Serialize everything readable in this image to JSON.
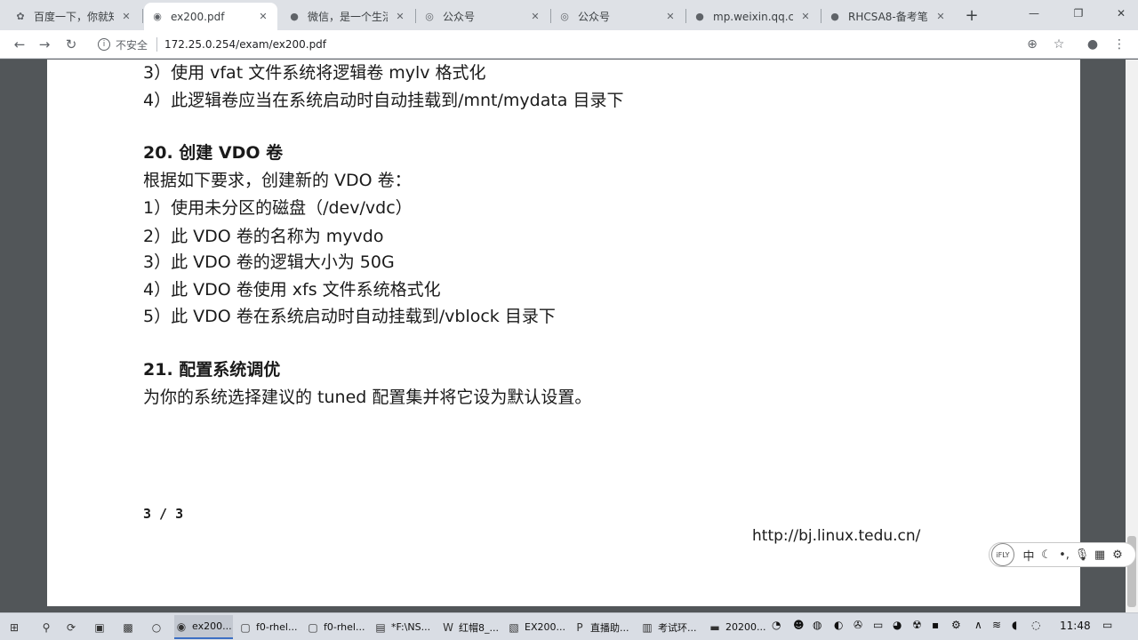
{
  "tabs": [
    {
      "title": "百度一下，你就知",
      "icon": "paw-icon"
    },
    {
      "title": "ex200.pdf",
      "icon": "globe-icon"
    },
    {
      "title": "微信，是一个生活",
      "icon": "chat-icon"
    },
    {
      "title": "公众号",
      "icon": "globe-icon"
    },
    {
      "title": "公众号",
      "icon": "globe-icon"
    },
    {
      "title": "mp.weixin.qq.co",
      "icon": "chat-icon"
    },
    {
      "title": "RHCSA8-备考笔",
      "icon": "chat-icon"
    }
  ],
  "active_tab": 1,
  "address": {
    "security_label": "不安全",
    "url": "172.25.0.254/exam/ex200.pdf"
  },
  "document": {
    "lines": [
      "3）使用 vfat 文件系统将逻辑卷 mylv 格式化",
      "4）此逻辑卷应当在系统启动时自动挂载到/mnt/mydata 目录下",
      "20. 创建 VDO 卷",
      "根据如下要求，创建新的 VDO 卷：",
      "1）使用未分区的磁盘（/dev/vdc）",
      "2）此 VDO 卷的名称为 myvdo",
      "3）此 VDO 卷的逻辑大小为 50G",
      "4）此 VDO 卷使用 xfs 文件系统格式化",
      "5）此 VDO 卷在系统启动时自动挂载到/vblock 目录下",
      "21. 配置系统调优",
      "为你的系统选择建议的 tuned 配置集并将它设为默认设置。"
    ],
    "page_number": "3 / 3",
    "footer_url": "http://bj.linux.tedu.cn/"
  },
  "ime": {
    "logo": "iFLY",
    "mode": "中"
  },
  "taskbar": {
    "items": [
      {
        "label": "ex200...",
        "icon": "chrome-icon"
      },
      {
        "label": "f0-rhel...",
        "icon": "vm-icon"
      },
      {
        "label": "f0-rhel...",
        "icon": "vm-icon"
      },
      {
        "label": "*F:\\NS...",
        "icon": "notepad-icon"
      },
      {
        "label": "红帽8_...",
        "icon": "word-icon"
      },
      {
        "label": "EX200...",
        "icon": "pdf-icon"
      },
      {
        "label": "直播助...",
        "icon": "app-icon"
      },
      {
        "label": "考试环...",
        "icon": "doc-icon"
      },
      {
        "label": "20200...",
        "icon": "folder-icon"
      }
    ],
    "clock": "11:48"
  }
}
